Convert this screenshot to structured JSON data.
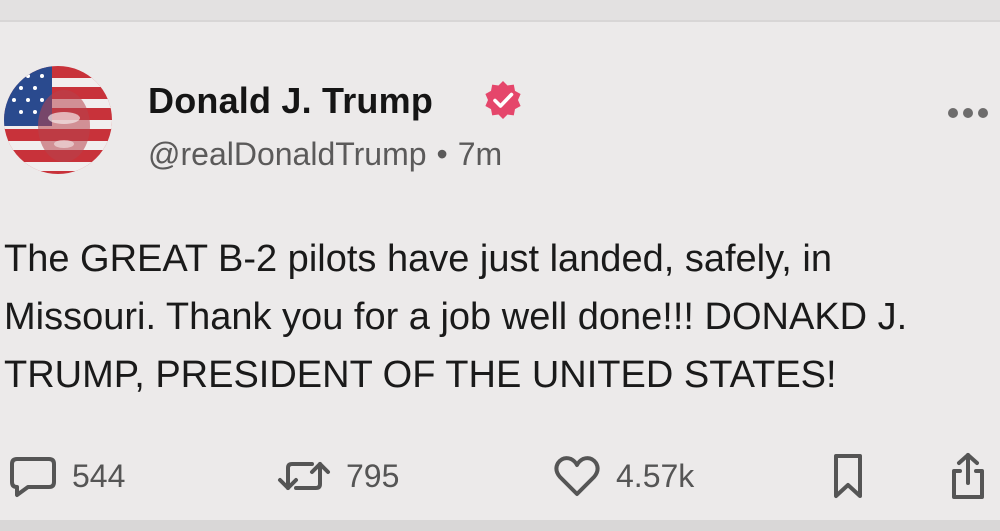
{
  "author": {
    "name": "Donald J. Trump",
    "handle": "@realDonaldTrump",
    "time": "7m",
    "separator": "•"
  },
  "post": {
    "text": "The GREAT B-2 pilots have just landed, safely, in Missouri. Thank you for a job well done!!! DONAKD J. TRUMP, PRESIDENT OF THE UNITED STATES!"
  },
  "actions": {
    "replies": "544",
    "reposts": "795",
    "likes": "4.57k"
  },
  "colors": {
    "verified": "#e5466b",
    "background": "#eceaea",
    "icon": "#555555"
  },
  "icons": {
    "verified": "verified-badge-icon",
    "more": "more-dots-icon",
    "reply": "reply-bubble-icon",
    "repost": "repost-arrows-icon",
    "like": "heart-icon",
    "bookmark": "bookmark-icon",
    "share": "share-icon"
  }
}
